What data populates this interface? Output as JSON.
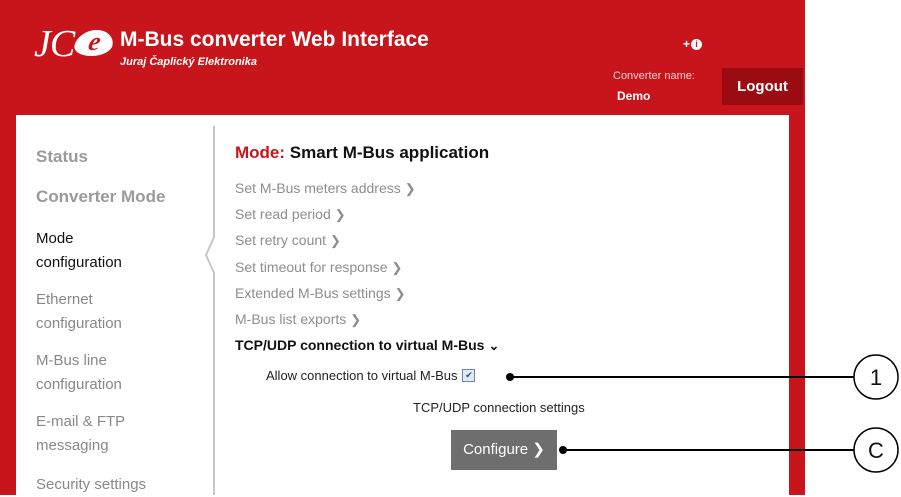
{
  "header": {
    "logo_text": "JC",
    "logo_e": "e",
    "title": "M-Bus converter Web Interface",
    "company": "Juraj Čaplický Elektronika",
    "lang_icon": "+",
    "lang_icon_glyph": "info-icon",
    "converter_name_label": "Converter name:",
    "converter_name_value": "Demo",
    "logout_label": "Logout"
  },
  "sidebar": {
    "items": [
      {
        "label": "Status"
      },
      {
        "label": "Converter Mode"
      },
      {
        "line1": "Mode",
        "line2": "configuration"
      },
      {
        "line1": "Ethernet",
        "line2": "configuration"
      },
      {
        "line1": "M-Bus line",
        "line2": "configuration"
      },
      {
        "line1": "E-mail & FTP",
        "line2": "messaging"
      },
      {
        "label": "Security settings"
      }
    ]
  },
  "main": {
    "mode_label": "Mode:",
    "mode_value": "Smart M-Bus application",
    "links": [
      "Set M-Bus meters address",
      "Set read period",
      "Set retry count",
      "Set timeout for response",
      "Extended M-Bus settings",
      "M-Bus list exports"
    ],
    "tcp_section": "TCP/UDP connection to virtual M-Bus",
    "allow_label": "Allow connection to virtual M-Bus",
    "allow_checked": true,
    "settings_label": "TCP/UDP connection settings",
    "configure_label": "Configure"
  },
  "callouts": {
    "first": "1",
    "second": "C"
  },
  "colors": {
    "brand_red": "#c8151b",
    "logout_bg": "#9b0c12",
    "button_gray": "#6e6e6e"
  }
}
